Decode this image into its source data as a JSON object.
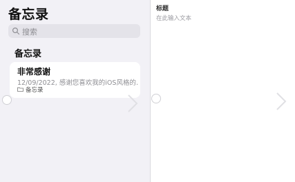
{
  "app": {
    "title": "备忘录"
  },
  "search": {
    "placeholder": "搜索",
    "icon": "search-icon"
  },
  "section": {
    "title": "备忘录"
  },
  "notes": [
    {
      "title": "非常感谢",
      "date": "12/09/2022",
      "preview": "感谢您喜欢我的iOS风格的...",
      "meta": "12/09/2022, 感谢您喜欢我的iOS风格的...",
      "folder": "备忘录",
      "folder_icon": "folder-icon"
    }
  ],
  "editor": {
    "title_label": "标题",
    "body_placeholder": "在此输入文本"
  },
  "colors": {
    "sidebar_bg": "#f2f1f6",
    "search_bg": "#e4e3e9",
    "card_bg": "#ffffff",
    "secondary_text": "#8e8e93"
  }
}
